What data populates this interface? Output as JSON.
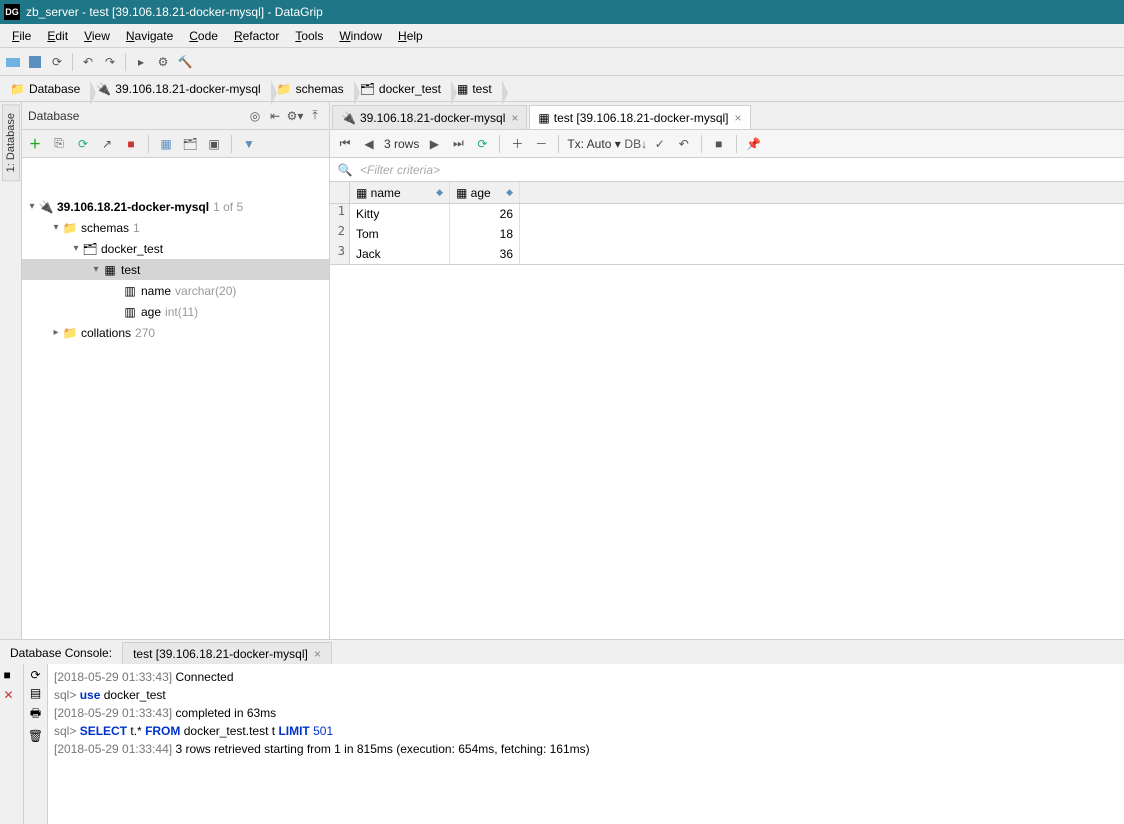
{
  "window_title": "zb_server - test [39.106.18.21-docker-mysql] - DataGrip",
  "menubar": [
    "File",
    "Edit",
    "View",
    "Navigate",
    "Code",
    "Refactor",
    "Tools",
    "Window",
    "Help"
  ],
  "breadcrumb": [
    "Database",
    "39.106.18.21-docker-mysql",
    "schemas",
    "docker_test",
    "test"
  ],
  "database_panel": {
    "title": "Database",
    "tree": {
      "datasource": "39.106.18.21-docker-mysql",
      "datasource_meta": "1 of 5",
      "schemas_label": "schemas",
      "schemas_meta": "1",
      "schema": "docker_test",
      "table": "test",
      "columns": [
        {
          "name": "name",
          "type": "varchar(20)"
        },
        {
          "name": "age",
          "type": "int(11)"
        }
      ],
      "collations_label": "collations",
      "collations_meta": "270"
    }
  },
  "sidebar_tab": "1: Database",
  "tabs": [
    {
      "label": "39.106.18.21-docker-mysql",
      "active": false
    },
    {
      "label": "test [39.106.18.21-docker-mysql]",
      "active": true
    }
  ],
  "grid": {
    "row_count_label": "3 rows",
    "tx_label": "Tx: Auto",
    "filter_placeholder": "<Filter criteria>",
    "columns": [
      "name",
      "age"
    ],
    "rows": [
      {
        "name": "Kitty",
        "age": 26
      },
      {
        "name": "Tom",
        "age": 18
      },
      {
        "name": "Jack",
        "age": 36
      }
    ]
  },
  "console": {
    "title": "Database Console:",
    "tab": "test [39.106.18.21-docker-mysql]",
    "lines": [
      {
        "ts": "[2018-05-29 01:33:43]",
        "text": "Connected"
      },
      {
        "prompt": "sql>",
        "kw": "use",
        "rest": "docker_test"
      },
      {
        "ts": "[2018-05-29 01:33:43]",
        "text": "completed in 63ms"
      },
      {
        "prompt": "sql>",
        "sql": "SELECT t.* FROM docker_test.test t LIMIT 501"
      },
      {
        "ts": "[2018-05-29 01:33:44]",
        "text": "3 rows retrieved starting from 1 in 815ms (execution: 654ms, fetching: 161ms)"
      }
    ]
  }
}
